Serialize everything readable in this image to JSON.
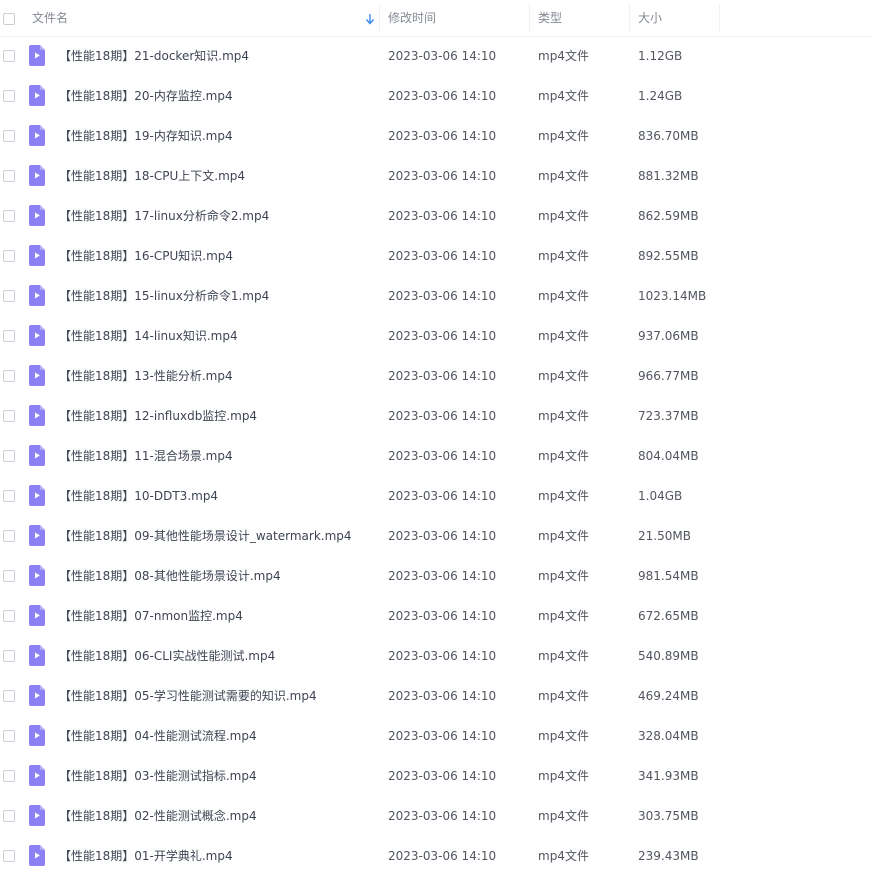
{
  "header": {
    "name_label": "文件名",
    "time_label": "修改时间",
    "type_label": "类型",
    "size_label": "大小"
  },
  "icons": {
    "file": "video-file-icon",
    "sort": "sort-arrow-down-icon"
  },
  "colors": {
    "icon_purple": "#8d7ff4",
    "sort_blue": "#3a8bf4"
  },
  "files": [
    {
      "name": "【性能18期】21-docker知识.mp4",
      "time": "2023-03-06 14:10",
      "type": "mp4文件",
      "size": "1.12GB"
    },
    {
      "name": "【性能18期】20-内存监控.mp4",
      "time": "2023-03-06 14:10",
      "type": "mp4文件",
      "size": "1.24GB"
    },
    {
      "name": "【性能18期】19-内存知识.mp4",
      "time": "2023-03-06 14:10",
      "type": "mp4文件",
      "size": "836.70MB"
    },
    {
      "name": "【性能18期】18-CPU上下文.mp4",
      "time": "2023-03-06 14:10",
      "type": "mp4文件",
      "size": "881.32MB"
    },
    {
      "name": "【性能18期】17-linux分析命令2.mp4",
      "time": "2023-03-06 14:10",
      "type": "mp4文件",
      "size": "862.59MB"
    },
    {
      "name": "【性能18期】16-CPU知识.mp4",
      "time": "2023-03-06 14:10",
      "type": "mp4文件",
      "size": "892.55MB"
    },
    {
      "name": "【性能18期】15-linux分析命令1.mp4",
      "time": "2023-03-06 14:10",
      "type": "mp4文件",
      "size": "1023.14MB"
    },
    {
      "name": "【性能18期】14-linux知识.mp4",
      "time": "2023-03-06 14:10",
      "type": "mp4文件",
      "size": "937.06MB"
    },
    {
      "name": "【性能18期】13-性能分析.mp4",
      "time": "2023-03-06 14:10",
      "type": "mp4文件",
      "size": "966.77MB"
    },
    {
      "name": "【性能18期】12-influxdb监控.mp4",
      "time": "2023-03-06 14:10",
      "type": "mp4文件",
      "size": "723.37MB"
    },
    {
      "name": "【性能18期】11-混合场景.mp4",
      "time": "2023-03-06 14:10",
      "type": "mp4文件",
      "size": "804.04MB"
    },
    {
      "name": "【性能18期】10-DDT3.mp4",
      "time": "2023-03-06 14:10",
      "type": "mp4文件",
      "size": "1.04GB"
    },
    {
      "name": "【性能18期】09-其他性能场景设计_watermark.mp4",
      "time": "2023-03-06 14:10",
      "type": "mp4文件",
      "size": "21.50MB"
    },
    {
      "name": "【性能18期】08-其他性能场景设计.mp4",
      "time": "2023-03-06 14:10",
      "type": "mp4文件",
      "size": "981.54MB"
    },
    {
      "name": "【性能18期】07-nmon监控.mp4",
      "time": "2023-03-06 14:10",
      "type": "mp4文件",
      "size": "672.65MB"
    },
    {
      "name": "【性能18期】06-CLI实战性能测试.mp4",
      "time": "2023-03-06 14:10",
      "type": "mp4文件",
      "size": "540.89MB"
    },
    {
      "name": "【性能18期】05-学习性能测试需要的知识.mp4",
      "time": "2023-03-06 14:10",
      "type": "mp4文件",
      "size": "469.24MB"
    },
    {
      "name": "【性能18期】04-性能测试流程.mp4",
      "time": "2023-03-06 14:10",
      "type": "mp4文件",
      "size": "328.04MB"
    },
    {
      "name": "【性能18期】03-性能测试指标.mp4",
      "time": "2023-03-06 14:10",
      "type": "mp4文件",
      "size": "341.93MB"
    },
    {
      "name": "【性能18期】02-性能测试概念.mp4",
      "time": "2023-03-06 14:10",
      "type": "mp4文件",
      "size": "303.75MB"
    },
    {
      "name": "【性能18期】01-开学典礼.mp4",
      "time": "2023-03-06 14:10",
      "type": "mp4文件",
      "size": "239.43MB"
    }
  ]
}
